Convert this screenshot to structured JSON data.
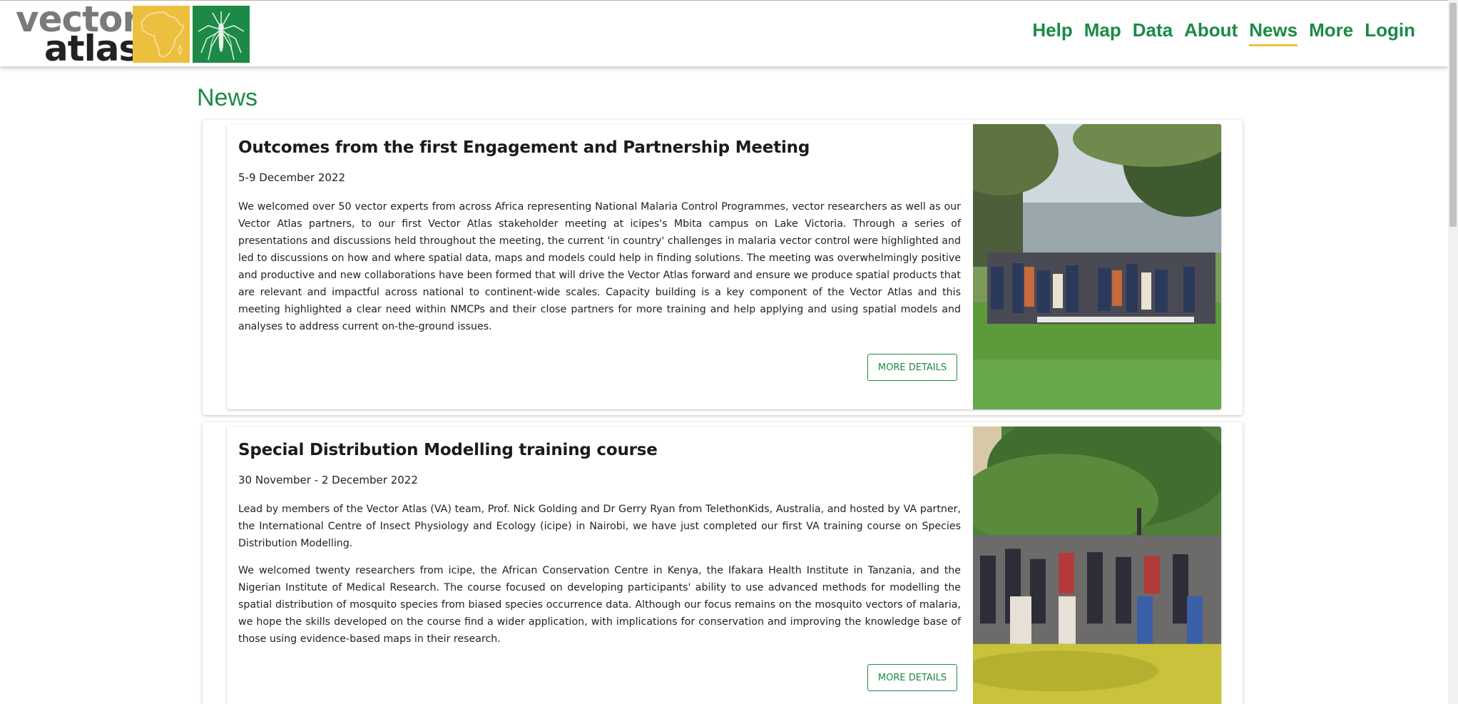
{
  "brand": {
    "word1": "vector",
    "word2": "atlas",
    "africa_icon": "africa-map-icon",
    "mosquito_icon": "mosquito-icon",
    "colors": {
      "green": "#1c8a46",
      "yellow": "#ecbf3f",
      "grey": "#7a7a7a"
    }
  },
  "nav": {
    "items": [
      "Help",
      "Map",
      "Data",
      "About",
      "News",
      "More",
      "Login"
    ],
    "active": "News"
  },
  "page": {
    "title": "News"
  },
  "articles": [
    {
      "title": "Outcomes from the first Engagement and Partnership Meeting",
      "date": "5-9 December 2022",
      "paragraphs": [
        "We welcomed over 50 vector experts from across Africa  representing National Malaria Control Programmes, vector researchers as well as our Vector Atlas partners, to our first Vector Atlas stakeholder meeting at icipes's Mbita campus on Lake Victoria.  Through a series of presentations and discussions held throughout the meeting, the current 'in country' challenges in malaria vector control were highlighted and led to discussions on how and where spatial data, maps and models could help in finding solutions. The meeting was overwhelmingly positive and productive and new collaborations have been formed that will drive the Vector Atlas forward and ensure  we produce spatial products that are relevant and impactful across national to continent-wide scales. Capacity building is a key component of the Vector Atlas and this meeting highlighted a clear need within NMCPs and their close partners for more training and help applying and using spatial models and analyses to address current on-the-ground issues."
      ],
      "button": "MORE DETAILS"
    },
    {
      "title": "Special Distribution Modelling training course",
      "date": "30 November - 2 December 2022",
      "paragraphs": [
        "Lead by members of the Vector Atlas (VA) team, Prof. Nick Golding and Dr Gerry Ryan from TelethonKids, Australia, and hosted by VA partner, the International Centre of Insect Physiology and Ecology (icipe) in Nairobi, we have just completed our first VA training course on Species Distribution Modelling.",
        "We welcomed twenty researchers from icipe, the African Conservation Centre in Kenya, the Ifakara Health Institute in Tanzania, and the Nigerian Institute of Medical Research. The course focused on developing participants' ability to use advanced methods for modelling the spatial distribution of mosquito species from biased species occurrence data. Although our focus remains on the mosquito vectors of malaria, we hope the skills developed on the course find a wider application, with implications for conservation and improving the knowledge base of those using evidence-based maps in their research."
      ],
      "button": "MORE DETAILS"
    }
  ]
}
